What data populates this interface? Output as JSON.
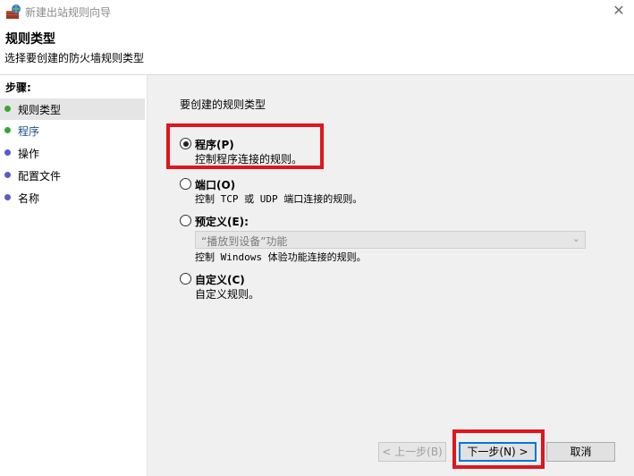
{
  "window": {
    "title": "新建出站规则向导",
    "close_glyph": "✕"
  },
  "header": {
    "title": "规则类型",
    "subtitle": "选择要创建的防火墙规则类型"
  },
  "sidebar": {
    "title": "步骤:",
    "items": [
      {
        "label": "规则类型",
        "dot_color": "#3aa534"
      },
      {
        "label": "程序",
        "dot_color": "#3aa534"
      },
      {
        "label": "操作",
        "dot_color": "#5b5bc8"
      },
      {
        "label": "配置文件",
        "dot_color": "#5b5bc8"
      },
      {
        "label": "名称",
        "dot_color": "#5b5bc8"
      }
    ]
  },
  "main": {
    "prompt": "要创建的规则类型",
    "options": [
      {
        "label": "程序(P)",
        "desc": "控制程序连接的规则。",
        "checked": true
      },
      {
        "label": "端口(O)",
        "desc": "控制 TCP 或 UDP 端口连接的规则。",
        "checked": false
      },
      {
        "label": "预定义(E):",
        "desc": "控制 Windows 体验功能连接的规则。",
        "checked": false
      },
      {
        "label": "自定义(C)",
        "desc": "自定义规则。",
        "checked": false
      }
    ],
    "predefined_dropdown": {
      "selected": "“播放到设备”功能",
      "arrow_glyph": "⌄"
    }
  },
  "buttons": {
    "back": "< 上一步(B)",
    "next": "下一步(N) >",
    "cancel": "取消"
  },
  "colors": {
    "highlight": "#e0151d",
    "panel_bg": "#f0f0f0",
    "active_step_bg": "#e5e5e5"
  }
}
